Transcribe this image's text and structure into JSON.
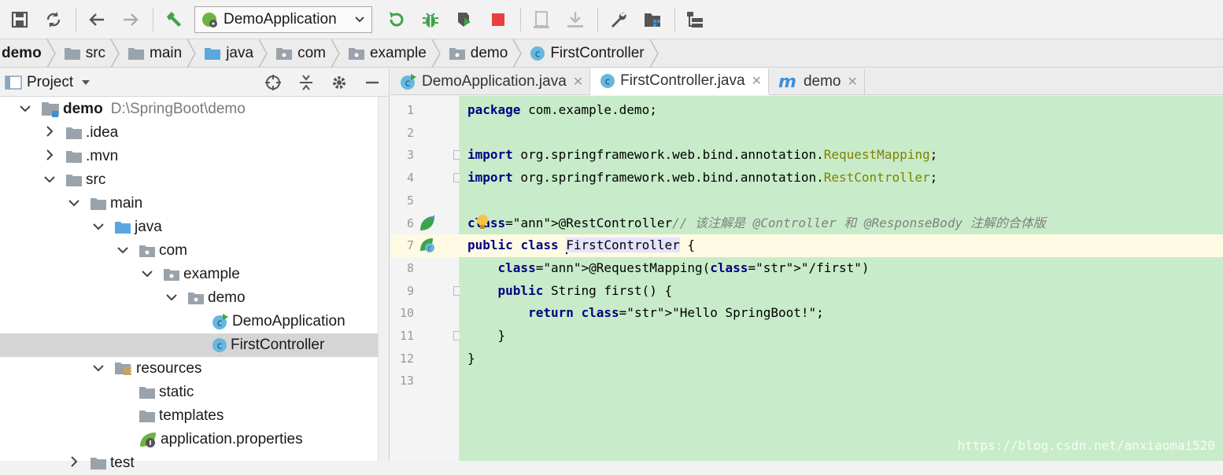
{
  "run_config": {
    "label": "DemoApplication"
  },
  "breadcrumb": [
    "demo",
    "src",
    "main",
    "java",
    "com",
    "example",
    "demo",
    "FirstController"
  ],
  "project_panel": {
    "title": "Project",
    "tree": [
      {
        "label": "demo",
        "hint": "D:\\SpringBoot\\demo",
        "level": 0,
        "expanded": true,
        "icon": "module-folder-icon",
        "bold": true
      },
      {
        "label": ".idea",
        "level": 1,
        "expanded": false,
        "icon": "folder-icon"
      },
      {
        "label": ".mvn",
        "level": 1,
        "expanded": false,
        "icon": "folder-icon"
      },
      {
        "label": "src",
        "level": 1,
        "expanded": true,
        "icon": "folder-icon"
      },
      {
        "label": "main",
        "level": 2,
        "expanded": true,
        "icon": "folder-icon"
      },
      {
        "label": "java",
        "level": 3,
        "expanded": true,
        "icon": "source-folder-icon"
      },
      {
        "label": "com",
        "level": 4,
        "expanded": true,
        "icon": "package-icon"
      },
      {
        "label": "example",
        "level": 5,
        "expanded": true,
        "icon": "package-icon"
      },
      {
        "label": "demo",
        "level": 6,
        "expanded": true,
        "icon": "package-icon"
      },
      {
        "label": "DemoApplication",
        "level": 7,
        "icon": "spring-class-icon"
      },
      {
        "label": "FirstController",
        "level": 7,
        "icon": "class-icon",
        "selected": true
      },
      {
        "label": "resources",
        "level": 3,
        "expanded": true,
        "icon": "resources-folder-icon"
      },
      {
        "label": "static",
        "level": 4,
        "icon": "folder-icon"
      },
      {
        "label": "templates",
        "level": 4,
        "icon": "folder-icon"
      },
      {
        "label": "application.properties",
        "level": 4,
        "icon": "spring-properties-icon"
      },
      {
        "label": "test",
        "level": 2,
        "expanded": false,
        "icon": "folder-icon"
      }
    ]
  },
  "tabs": [
    {
      "label": "DemoApplication.java",
      "icon": "spring-class-icon",
      "active": false
    },
    {
      "label": "FirstController.java",
      "icon": "class-icon",
      "active": true
    },
    {
      "label": "demo",
      "icon": "maven-icon",
      "active": false
    }
  ],
  "editor": {
    "line_numbers": [
      "1",
      "2",
      "3",
      "4",
      "5",
      "6",
      "7",
      "8",
      "9",
      "10",
      "11",
      "12",
      "13"
    ],
    "current_line": 7,
    "lines": [
      {
        "t": "package com.example.demo;"
      },
      {
        "t": ""
      },
      {
        "t": "import org.springframework.web.bind.annotation.RequestMapping;"
      },
      {
        "t": "import org.springframework.web.bind.annotation.RestController;"
      },
      {
        "t": ""
      },
      {
        "t": "@RestController// 该注解是 @Controller 和 @ResponseBody 注解的合体版"
      },
      {
        "t": "public class FirstController {"
      },
      {
        "t": "    @RequestMapping(\"/first\")"
      },
      {
        "t": "    public String first() {"
      },
      {
        "t": "        return \"Hello SpringBoot!\";"
      },
      {
        "t": "    }"
      },
      {
        "t": "}"
      },
      {
        "t": ""
      }
    ]
  },
  "watermark": "https://blog.csdn.net/anxiaomai520",
  "colors": {
    "code_bg": "#c8ecc9",
    "current_line_bg": "#fffae3",
    "keyword": "#000080",
    "annotation": "#808000",
    "string": "#008000",
    "comment": "#808080",
    "stop_red": "#e8403e",
    "run_green": "#3ea34a"
  }
}
